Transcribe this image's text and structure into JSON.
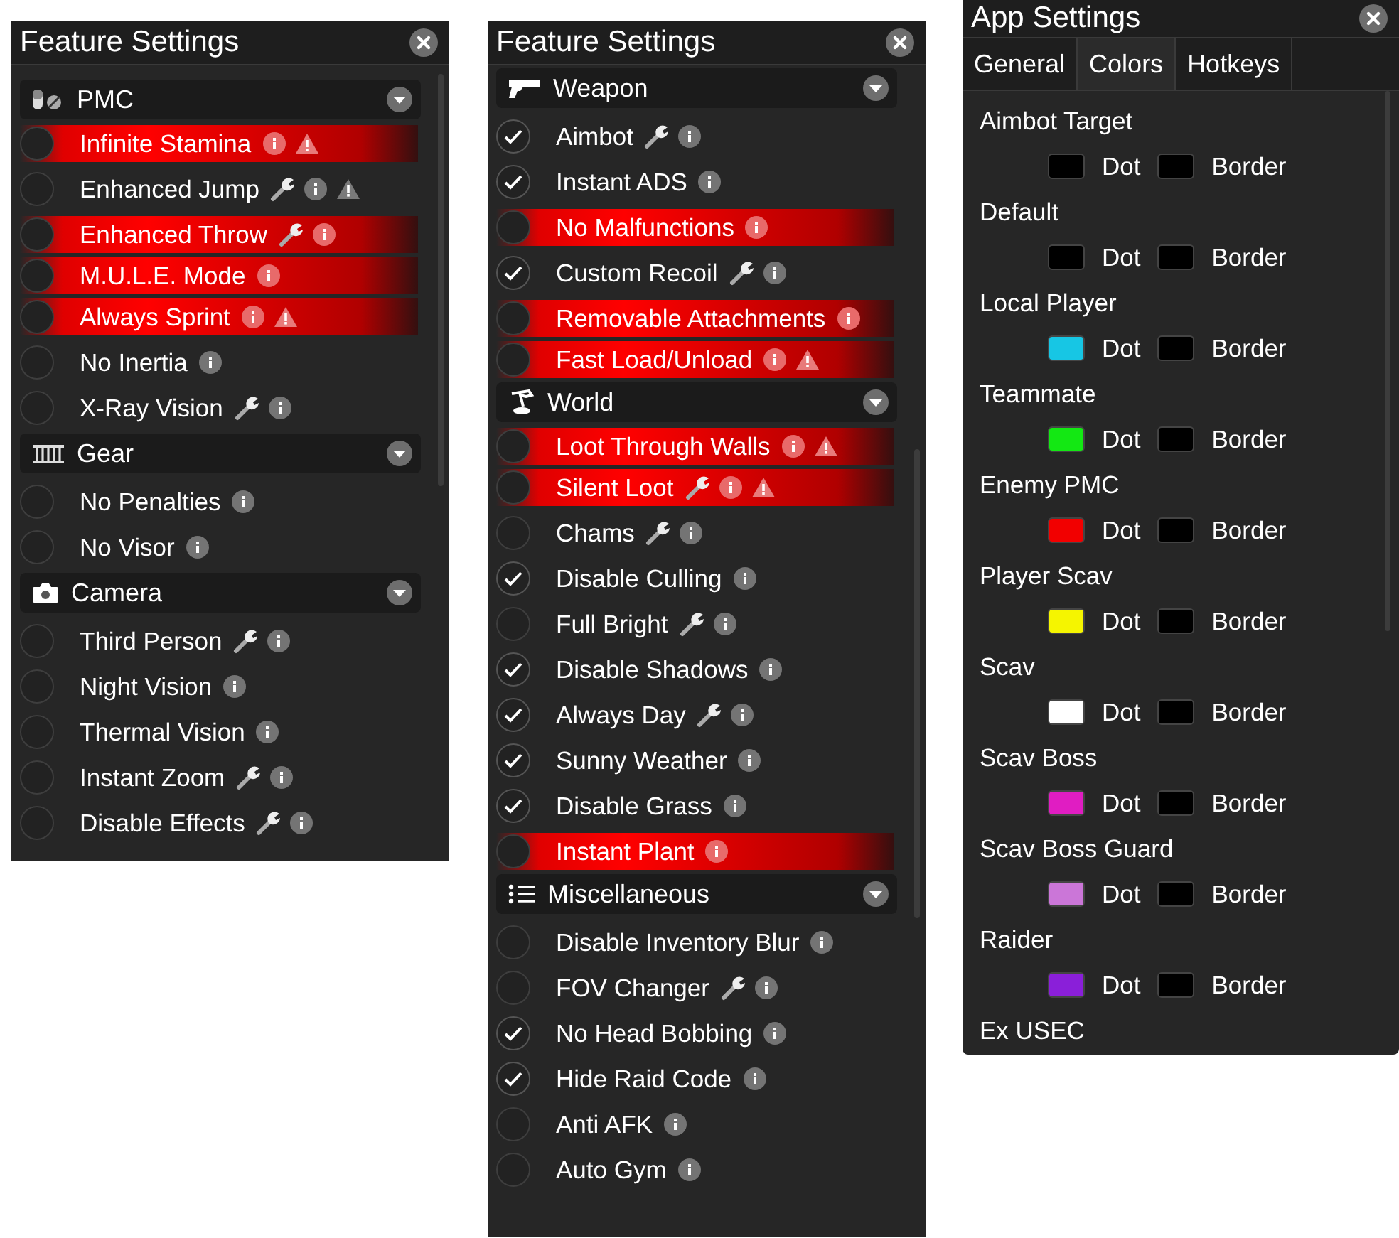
{
  "feature_panels": [
    {
      "title": "Feature Settings",
      "sections": [
        {
          "title": "PMC",
          "expanded": true,
          "items": [
            {
              "label": "Infinite Stamina",
              "checked": false,
              "highlighted": true,
              "wrench": false,
              "warning": true
            },
            {
              "label": "Enhanced Jump",
              "checked": false,
              "highlighted": false,
              "wrench": true,
              "warning": true
            },
            {
              "label": "Enhanced Throw",
              "checked": false,
              "highlighted": true,
              "wrench": true,
              "warning": false
            },
            {
              "label": "M.U.L.E. Mode",
              "checked": false,
              "highlighted": true,
              "wrench": false,
              "warning": false
            },
            {
              "label": "Always Sprint",
              "checked": false,
              "highlighted": true,
              "wrench": false,
              "warning": true
            },
            {
              "label": "No Inertia",
              "checked": false,
              "highlighted": false,
              "wrench": false,
              "warning": false
            },
            {
              "label": "X-Ray Vision",
              "checked": false,
              "highlighted": false,
              "wrench": true,
              "warning": false
            }
          ]
        },
        {
          "title": "Gear",
          "expanded": true,
          "items": [
            {
              "label": "No Penalties",
              "checked": false,
              "highlighted": false,
              "wrench": false,
              "warning": false
            },
            {
              "label": "No Visor",
              "checked": false,
              "highlighted": false,
              "wrench": false,
              "warning": false
            }
          ]
        },
        {
          "title": "Camera",
          "expanded": true,
          "items": [
            {
              "label": "Third Person",
              "checked": false,
              "highlighted": false,
              "wrench": true,
              "warning": false
            },
            {
              "label": "Night Vision",
              "checked": false,
              "highlighted": false,
              "wrench": false,
              "warning": false
            },
            {
              "label": "Thermal Vision",
              "checked": false,
              "highlighted": false,
              "wrench": false,
              "warning": false
            },
            {
              "label": "Instant Zoom",
              "checked": false,
              "highlighted": false,
              "wrench": true,
              "warning": false
            },
            {
              "label": "Disable Effects",
              "checked": false,
              "highlighted": false,
              "wrench": true,
              "warning": false
            }
          ]
        }
      ]
    },
    {
      "title": "Feature Settings",
      "sections": [
        {
          "title": "Weapon",
          "expanded": true,
          "items": [
            {
              "label": "Aimbot",
              "checked": true,
              "highlighted": false,
              "wrench": true,
              "warning": false
            },
            {
              "label": "Instant ADS",
              "checked": true,
              "highlighted": false,
              "wrench": false,
              "warning": false
            },
            {
              "label": "No Malfunctions",
              "checked": false,
              "highlighted": true,
              "wrench": false,
              "warning": false
            },
            {
              "label": "Custom Recoil",
              "checked": true,
              "highlighted": false,
              "wrench": true,
              "warning": false
            },
            {
              "label": "Removable Attachments",
              "checked": false,
              "highlighted": true,
              "wrench": false,
              "warning": false
            },
            {
              "label": "Fast Load/Unload",
              "checked": false,
              "highlighted": true,
              "wrench": false,
              "warning": true
            }
          ]
        },
        {
          "title": "World",
          "expanded": true,
          "items": [
            {
              "label": "Loot Through Walls",
              "checked": false,
              "highlighted": true,
              "wrench": false,
              "warning": true
            },
            {
              "label": "Silent Loot",
              "checked": false,
              "highlighted": true,
              "wrench": true,
              "warning": true
            },
            {
              "label": "Chams",
              "checked": false,
              "highlighted": false,
              "wrench": true,
              "warning": false
            },
            {
              "label": "Disable Culling",
              "checked": true,
              "highlighted": false,
              "wrench": false,
              "warning": false
            },
            {
              "label": "Full Bright",
              "checked": false,
              "highlighted": false,
              "wrench": true,
              "warning": false
            },
            {
              "label": "Disable Shadows",
              "checked": true,
              "highlighted": false,
              "wrench": false,
              "warning": false
            },
            {
              "label": "Always Day",
              "checked": true,
              "highlighted": false,
              "wrench": true,
              "warning": false
            },
            {
              "label": "Sunny Weather",
              "checked": true,
              "highlighted": false,
              "wrench": false,
              "warning": false
            },
            {
              "label": "Disable Grass",
              "checked": true,
              "highlighted": false,
              "wrench": false,
              "warning": false
            },
            {
              "label": "Instant Plant",
              "checked": false,
              "highlighted": true,
              "wrench": false,
              "warning": false
            }
          ]
        },
        {
          "title": "Miscellaneous",
          "expanded": true,
          "items": [
            {
              "label": "Disable Inventory Blur",
              "checked": false,
              "highlighted": false,
              "wrench": false,
              "warning": false
            },
            {
              "label": "FOV Changer",
              "checked": false,
              "highlighted": false,
              "wrench": true,
              "warning": false
            },
            {
              "label": "No Head Bobbing",
              "checked": true,
              "highlighted": false,
              "wrench": false,
              "warning": false
            },
            {
              "label": "Hide Raid Code",
              "checked": true,
              "highlighted": false,
              "wrench": false,
              "warning": false
            },
            {
              "label": "Anti AFK",
              "checked": false,
              "highlighted": false,
              "wrench": false,
              "warning": false
            },
            {
              "label": "Auto Gym",
              "checked": false,
              "highlighted": false,
              "wrench": false,
              "warning": false
            }
          ]
        }
      ]
    }
  ],
  "app_settings": {
    "title": "App Settings",
    "tabs": [
      {
        "label": "General",
        "selected": false
      },
      {
        "label": "Colors",
        "selected": true
      },
      {
        "label": "Hotkeys",
        "selected": false
      }
    ],
    "colors": [
      {
        "name": "Aimbot Target",
        "dot": {
          "label": "Dot",
          "color": "#000000"
        },
        "border": {
          "label": "Border",
          "color": "#000000"
        }
      },
      {
        "name": "Default",
        "dot": {
          "label": "Dot",
          "color": "#000000"
        },
        "border": {
          "label": "Border",
          "color": "#000000"
        }
      },
      {
        "name": "Local Player",
        "dot": {
          "label": "Dot",
          "color": "#17c6e4"
        },
        "border": {
          "label": "Border",
          "color": "#000000"
        }
      },
      {
        "name": "Teammate",
        "dot": {
          "label": "Dot",
          "color": "#13e813"
        },
        "border": {
          "label": "Border",
          "color": "#000000"
        }
      },
      {
        "name": "Enemy PMC",
        "dot": {
          "label": "Dot",
          "color": "#f20000"
        },
        "border": {
          "label": "Border",
          "color": "#000000"
        }
      },
      {
        "name": "Player Scav",
        "dot": {
          "label": "Dot",
          "color": "#f5f500"
        },
        "border": {
          "label": "Border",
          "color": "#000000"
        }
      },
      {
        "name": "Scav",
        "dot": {
          "label": "Dot",
          "color": "#ffffff"
        },
        "border": {
          "label": "Border",
          "color": "#000000"
        }
      },
      {
        "name": "Scav Boss",
        "dot": {
          "label": "Dot",
          "color": "#e01dc2"
        },
        "border": {
          "label": "Border",
          "color": "#000000"
        }
      },
      {
        "name": "Scav Boss Guard",
        "dot": {
          "label": "Dot",
          "color": "#cb76d8"
        },
        "border": {
          "label": "Border",
          "color": "#000000"
        }
      },
      {
        "name": "Raider",
        "dot": {
          "label": "Dot",
          "color": "#8a1fd9"
        },
        "border": {
          "label": "Border",
          "color": "#000000"
        }
      },
      {
        "name": "Ex USEC"
      }
    ]
  }
}
